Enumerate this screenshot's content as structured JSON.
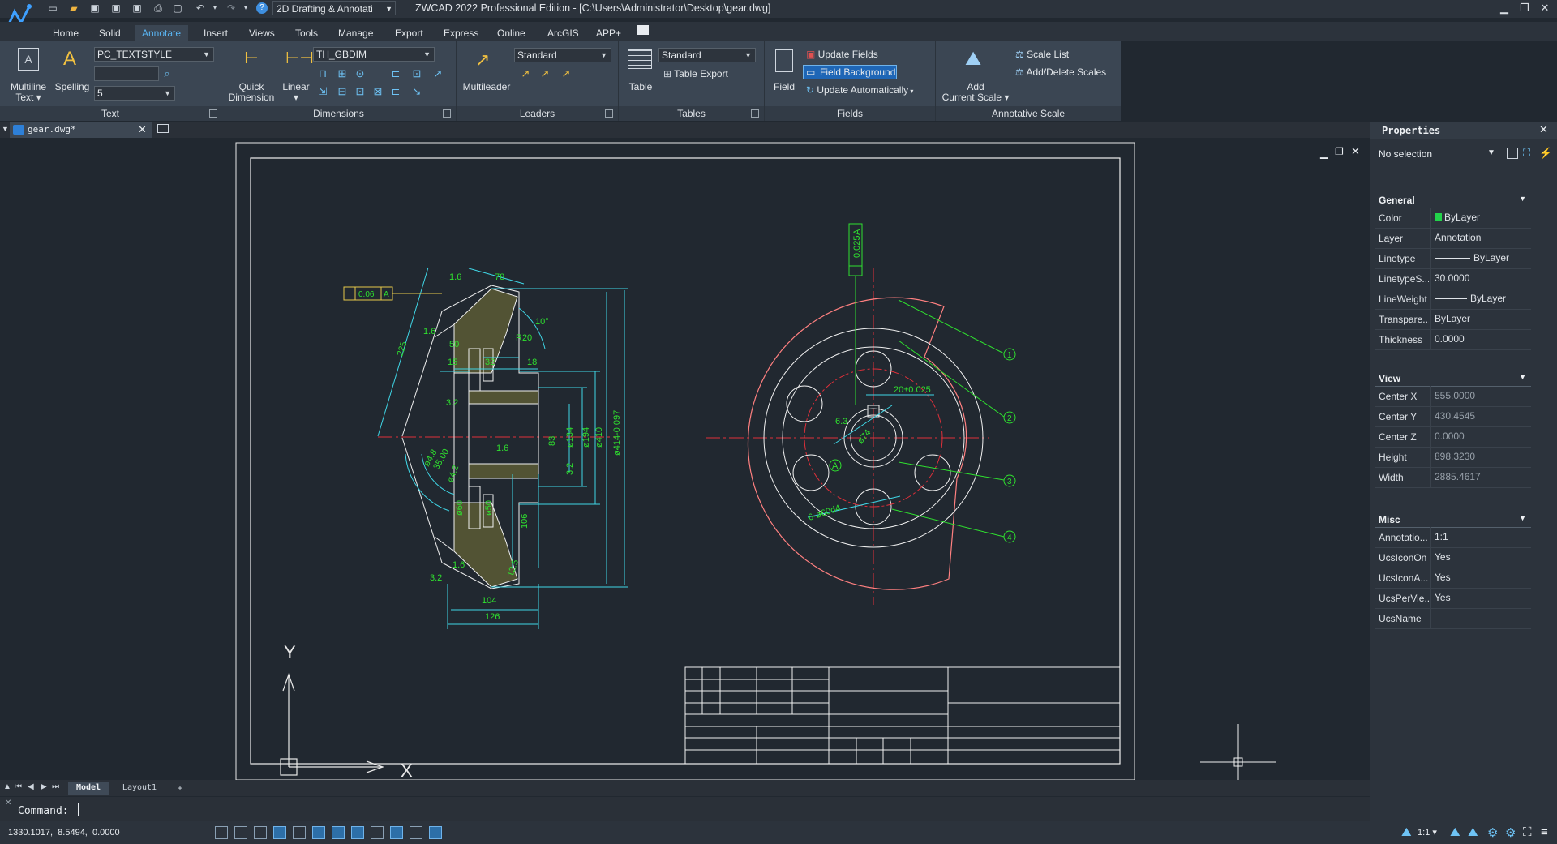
{
  "app": {
    "title": "ZWCAD 2022 Professional Edition - [C:\\Users\\Administrator\\Desktop\\gear.dwg]",
    "workspace": "2D Drafting & Annotati"
  },
  "quick_access": [
    "new-icon",
    "open-icon",
    "save-icon",
    "saveas-icon",
    "saveall-icon",
    "print-icon",
    "plot-preview-icon",
    "undo-icon",
    "redo-icon",
    "help-icon"
  ],
  "menu_tabs": [
    "Home",
    "Solid",
    "Annotate",
    "Insert",
    "Views",
    "Tools",
    "Manage",
    "Export",
    "Express",
    "Online",
    "ArcGIS",
    "APP+"
  ],
  "active_tab": "Annotate",
  "ribbon": {
    "text": {
      "multiline": "Multiline",
      "multiline2": "Text ▾",
      "spelling": "Spelling",
      "style": "PC_TEXTSTYLE",
      "height": "5",
      "footer": "Text"
    },
    "dimensions": {
      "quick": "Quick",
      "quick2": "Dimension",
      "linear": "Linear",
      "linear2": "▾",
      "style": "TH_GBDIM",
      "footer": "Dimensions"
    },
    "leaders": {
      "multileader": "Multileader",
      "style": "Standard",
      "footer": "Leaders"
    },
    "tables": {
      "table": "Table",
      "style": "Standard",
      "export": "Table Export",
      "footer": "Tables"
    },
    "fields": {
      "field": "Field",
      "update": "Update Fields",
      "background": "Field Background",
      "auto": "Update Automatically",
      "footer": "Fields"
    },
    "scale": {
      "add": "Add",
      "add2": "Current Scale ▾",
      "list": "Scale List",
      "adddel": "Add/Delete Scales",
      "footer": "Annotative Scale"
    }
  },
  "document_tab": "gear.dwg*",
  "drawing": {
    "tol_box": [
      "0.06",
      "A"
    ],
    "left_dims": [
      "78",
      "1.6",
      "10°",
      "R20",
      "1.6",
      "225",
      "50",
      "18",
      "32",
      "15",
      "3.2",
      "1.6",
      "83",
      "ø134",
      "ø194",
      "ø410",
      "ø414-0.097",
      "ø4.8",
      "35.00",
      "ø4.2",
      "ø60",
      "ø50",
      "106",
      "3.2",
      "12.5",
      "104",
      "126",
      "3.2",
      "1.6"
    ],
    "right_dims": [
      "0.025",
      "A",
      "20±0.025",
      "ø74",
      "6.3",
      "6-ø60d4",
      "A"
    ],
    "balloons": [
      "1",
      "2",
      "3",
      "4"
    ],
    "ucs_y": "Y",
    "ucs_x": "X"
  },
  "layout_tabs": [
    "Model",
    "Layout1",
    "+"
  ],
  "command": {
    "label": "Command:"
  },
  "status": {
    "coords": "1330.1017,  8.5494,  0.0000",
    "scale": "1:1 ▾"
  },
  "properties": {
    "title": "Properties",
    "selection": "No selection",
    "sections": {
      "general": {
        "label": "General",
        "rows": [
          {
            "k": "Color",
            "v": "ByLayer"
          },
          {
            "k": "Layer",
            "v": "Annotation"
          },
          {
            "k": "Linetype",
            "v": "ByLayer"
          },
          {
            "k": "LinetypeS...",
            "v": "30.0000"
          },
          {
            "k": "LineWeight",
            "v": "ByLayer"
          },
          {
            "k": "Transpare...",
            "v": "ByLayer"
          },
          {
            "k": "Thickness",
            "v": "0.0000"
          }
        ]
      },
      "view": {
        "label": "View",
        "rows": [
          {
            "k": "Center X",
            "v": "555.0000"
          },
          {
            "k": "Center Y",
            "v": "430.4545"
          },
          {
            "k": "Center Z",
            "v": "0.0000"
          },
          {
            "k": "Height",
            "v": "898.3230"
          },
          {
            "k": "Width",
            "v": "2885.4617"
          }
        ]
      },
      "misc": {
        "label": "Misc",
        "rows": [
          {
            "k": "Annotatio...",
            "v": "1:1"
          },
          {
            "k": "UcsIconOn",
            "v": "Yes"
          },
          {
            "k": "UcsIconA...",
            "v": "Yes"
          },
          {
            "k": "UcsPerVie...",
            "v": "Yes"
          },
          {
            "k": "UcsName",
            "v": ""
          }
        ]
      }
    }
  },
  "colors": {
    "accent": "#59b3f0",
    "cyan": "#3fd6e6",
    "green": "#2fe02f",
    "red": "#e0303a",
    "yellow": "#e5c84a"
  }
}
